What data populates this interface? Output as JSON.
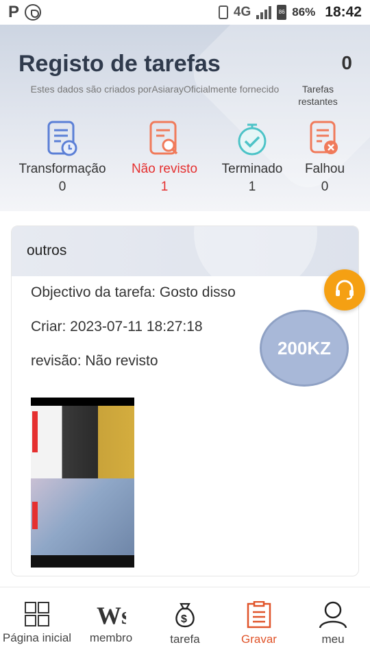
{
  "status_bar": {
    "network": "4G",
    "battery_level": "86",
    "battery_percent": "86%",
    "time": "18:42"
  },
  "header": {
    "title": "Registo de tarefas",
    "subtitle": "Estes dados são criados porAsiarayOficialmente fornecido",
    "remaining_count": "0",
    "remaining_label": "Tarefas restantes"
  },
  "stats": [
    {
      "label": "Transformação",
      "value": "0",
      "icon": "document-clock-icon",
      "color": "#5b7fd6"
    },
    {
      "label": "Não revisto",
      "value": "1",
      "icon": "document-search-icon",
      "color": "#f07a5a"
    },
    {
      "label": "Terminado",
      "value": "1",
      "icon": "check-circle-icon",
      "color": "#4cc3c7"
    },
    {
      "label": "Falhou",
      "value": "0",
      "icon": "document-error-icon",
      "color": "#f07a5a"
    }
  ],
  "task_card": {
    "category": "outros",
    "objective": "Objectivo da tarefa: Gosto disso",
    "created": "Criar: 2023-07-11 18:27:18",
    "review": "revisão: Não revisto",
    "reward": "200KZ",
    "thumbnail_alt": "task-proof-screenshot"
  },
  "support": {
    "icon": "headset-icon"
  },
  "nav": [
    {
      "label": "Página inicial",
      "icon": "grid-icon",
      "active": false
    },
    {
      "label": "membro",
      "icon": "ws-logo-icon",
      "active": false
    },
    {
      "label": "tarefa",
      "icon": "money-bag-icon",
      "active": false
    },
    {
      "label": "Gravar",
      "icon": "clipboard-icon",
      "active": true
    },
    {
      "label": "meu",
      "icon": "user-icon",
      "active": false
    }
  ]
}
